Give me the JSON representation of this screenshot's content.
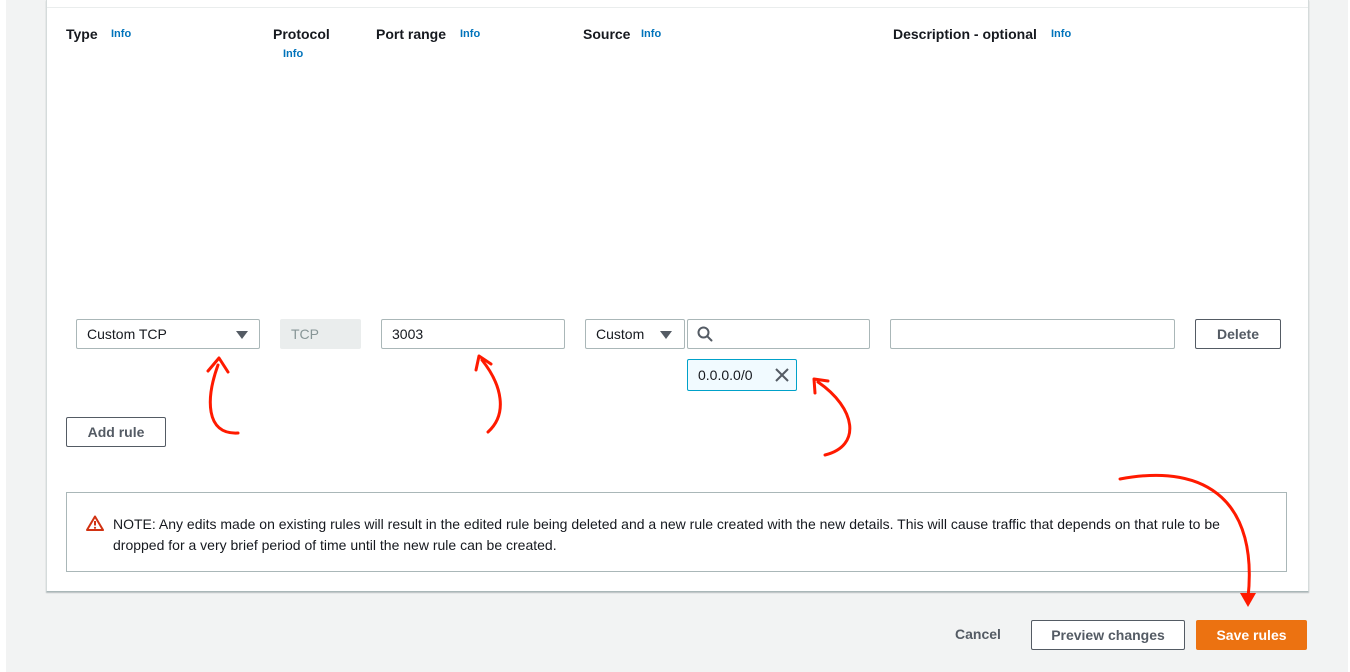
{
  "columns": {
    "type": {
      "label": "Type",
      "info": "Info"
    },
    "protocol": {
      "label": "Protocol",
      "info": "Info"
    },
    "port_range": {
      "label": "Port range",
      "info": "Info"
    },
    "source": {
      "label": "Source",
      "info": "Info"
    },
    "description": {
      "label": "Description - optional",
      "info": "Info"
    }
  },
  "rule": {
    "type_value": "Custom TCP",
    "protocol_value": "TCP",
    "port_value": "3003",
    "source_mode": "Custom",
    "source_search": "",
    "source_token": "0.0.0.0/0",
    "description_value": "",
    "delete_label": "Delete"
  },
  "add_rule_label": "Add rule",
  "notice": {
    "text": "NOTE: Any edits made on existing rules will result in the edited rule being deleted and a new rule created with the new details. This will cause traffic that depends on that rule to be dropped for a very brief period of time until the new rule can be created."
  },
  "footer": {
    "cancel_label": "Cancel",
    "preview_label": "Preview changes",
    "save_label": "Save rules"
  },
  "colors": {
    "accent": "#ec7211",
    "link": "#0073bb",
    "warning": "#d13212",
    "annotation": "#ff1a00"
  }
}
